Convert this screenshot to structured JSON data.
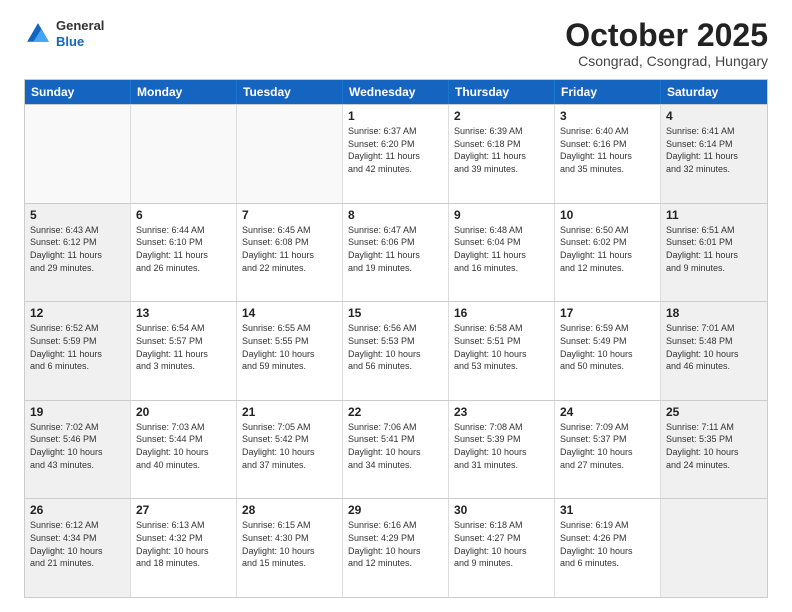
{
  "header": {
    "logo_general": "General",
    "logo_blue": "Blue",
    "month_title": "October 2025",
    "subtitle": "Csongrad, Csongrad, Hungary"
  },
  "days_of_week": [
    "Sunday",
    "Monday",
    "Tuesday",
    "Wednesday",
    "Thursday",
    "Friday",
    "Saturday"
  ],
  "weeks": [
    [
      {
        "day": "",
        "text": "",
        "empty": true
      },
      {
        "day": "",
        "text": "",
        "empty": true
      },
      {
        "day": "",
        "text": "",
        "empty": true
      },
      {
        "day": "1",
        "text": "Sunrise: 6:37 AM\nSunset: 6:20 PM\nDaylight: 11 hours\nand 42 minutes.",
        "empty": false
      },
      {
        "day": "2",
        "text": "Sunrise: 6:39 AM\nSunset: 6:18 PM\nDaylight: 11 hours\nand 39 minutes.",
        "empty": false
      },
      {
        "day": "3",
        "text": "Sunrise: 6:40 AM\nSunset: 6:16 PM\nDaylight: 11 hours\nand 35 minutes.",
        "empty": false
      },
      {
        "day": "4",
        "text": "Sunrise: 6:41 AM\nSunset: 6:14 PM\nDaylight: 11 hours\nand 32 minutes.",
        "empty": false,
        "shaded": true
      }
    ],
    [
      {
        "day": "5",
        "text": "Sunrise: 6:43 AM\nSunset: 6:12 PM\nDaylight: 11 hours\nand 29 minutes.",
        "empty": false,
        "shaded": true
      },
      {
        "day": "6",
        "text": "Sunrise: 6:44 AM\nSunset: 6:10 PM\nDaylight: 11 hours\nand 26 minutes.",
        "empty": false
      },
      {
        "day": "7",
        "text": "Sunrise: 6:45 AM\nSunset: 6:08 PM\nDaylight: 11 hours\nand 22 minutes.",
        "empty": false
      },
      {
        "day": "8",
        "text": "Sunrise: 6:47 AM\nSunset: 6:06 PM\nDaylight: 11 hours\nand 19 minutes.",
        "empty": false
      },
      {
        "day": "9",
        "text": "Sunrise: 6:48 AM\nSunset: 6:04 PM\nDaylight: 11 hours\nand 16 minutes.",
        "empty": false
      },
      {
        "day": "10",
        "text": "Sunrise: 6:50 AM\nSunset: 6:02 PM\nDaylight: 11 hours\nand 12 minutes.",
        "empty": false
      },
      {
        "day": "11",
        "text": "Sunrise: 6:51 AM\nSunset: 6:01 PM\nDaylight: 11 hours\nand 9 minutes.",
        "empty": false,
        "shaded": true
      }
    ],
    [
      {
        "day": "12",
        "text": "Sunrise: 6:52 AM\nSunset: 5:59 PM\nDaylight: 11 hours\nand 6 minutes.",
        "empty": false,
        "shaded": true
      },
      {
        "day": "13",
        "text": "Sunrise: 6:54 AM\nSunset: 5:57 PM\nDaylight: 11 hours\nand 3 minutes.",
        "empty": false
      },
      {
        "day": "14",
        "text": "Sunrise: 6:55 AM\nSunset: 5:55 PM\nDaylight: 10 hours\nand 59 minutes.",
        "empty": false
      },
      {
        "day": "15",
        "text": "Sunrise: 6:56 AM\nSunset: 5:53 PM\nDaylight: 10 hours\nand 56 minutes.",
        "empty": false
      },
      {
        "day": "16",
        "text": "Sunrise: 6:58 AM\nSunset: 5:51 PM\nDaylight: 10 hours\nand 53 minutes.",
        "empty": false
      },
      {
        "day": "17",
        "text": "Sunrise: 6:59 AM\nSunset: 5:49 PM\nDaylight: 10 hours\nand 50 minutes.",
        "empty": false
      },
      {
        "day": "18",
        "text": "Sunrise: 7:01 AM\nSunset: 5:48 PM\nDaylight: 10 hours\nand 46 minutes.",
        "empty": false,
        "shaded": true
      }
    ],
    [
      {
        "day": "19",
        "text": "Sunrise: 7:02 AM\nSunset: 5:46 PM\nDaylight: 10 hours\nand 43 minutes.",
        "empty": false,
        "shaded": true
      },
      {
        "day": "20",
        "text": "Sunrise: 7:03 AM\nSunset: 5:44 PM\nDaylight: 10 hours\nand 40 minutes.",
        "empty": false
      },
      {
        "day": "21",
        "text": "Sunrise: 7:05 AM\nSunset: 5:42 PM\nDaylight: 10 hours\nand 37 minutes.",
        "empty": false
      },
      {
        "day": "22",
        "text": "Sunrise: 7:06 AM\nSunset: 5:41 PM\nDaylight: 10 hours\nand 34 minutes.",
        "empty": false
      },
      {
        "day": "23",
        "text": "Sunrise: 7:08 AM\nSunset: 5:39 PM\nDaylight: 10 hours\nand 31 minutes.",
        "empty": false
      },
      {
        "day": "24",
        "text": "Sunrise: 7:09 AM\nSunset: 5:37 PM\nDaylight: 10 hours\nand 27 minutes.",
        "empty": false
      },
      {
        "day": "25",
        "text": "Sunrise: 7:11 AM\nSunset: 5:35 PM\nDaylight: 10 hours\nand 24 minutes.",
        "empty": false,
        "shaded": true
      }
    ],
    [
      {
        "day": "26",
        "text": "Sunrise: 6:12 AM\nSunset: 4:34 PM\nDaylight: 10 hours\nand 21 minutes.",
        "empty": false,
        "shaded": true
      },
      {
        "day": "27",
        "text": "Sunrise: 6:13 AM\nSunset: 4:32 PM\nDaylight: 10 hours\nand 18 minutes.",
        "empty": false
      },
      {
        "day": "28",
        "text": "Sunrise: 6:15 AM\nSunset: 4:30 PM\nDaylight: 10 hours\nand 15 minutes.",
        "empty": false
      },
      {
        "day": "29",
        "text": "Sunrise: 6:16 AM\nSunset: 4:29 PM\nDaylight: 10 hours\nand 12 minutes.",
        "empty": false
      },
      {
        "day": "30",
        "text": "Sunrise: 6:18 AM\nSunset: 4:27 PM\nDaylight: 10 hours\nand 9 minutes.",
        "empty": false
      },
      {
        "day": "31",
        "text": "Sunrise: 6:19 AM\nSunset: 4:26 PM\nDaylight: 10 hours\nand 6 minutes.",
        "empty": false
      },
      {
        "day": "",
        "text": "",
        "empty": true,
        "shaded": true
      }
    ]
  ]
}
